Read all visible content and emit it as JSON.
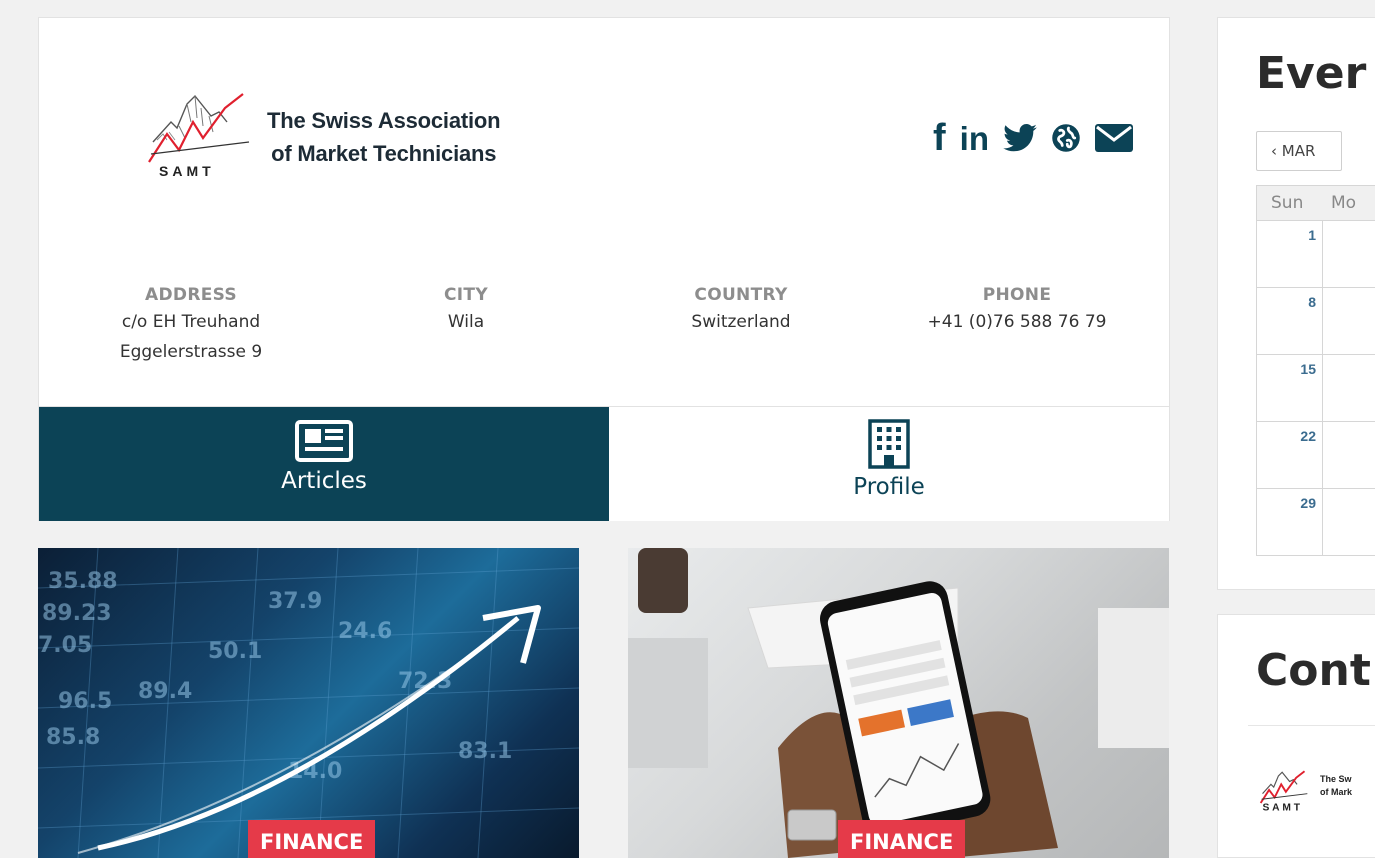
{
  "profile": {
    "logo_text_line1": "The Swiss Association",
    "logo_text_line2": "of Market Technicians",
    "logo_abbrev": "SAMT",
    "social": [
      "facebook-icon",
      "linkedin-icon",
      "twitter-icon",
      "globe-icon",
      "envelope-icon"
    ],
    "address": {
      "label": "ADDRESS",
      "line1": "c/o EH Treuhand",
      "line2": "Eggelerstrasse 9"
    },
    "city": {
      "label": "CITY",
      "value": "Wila"
    },
    "country": {
      "label": "COUNTRY",
      "value": "Switzerland"
    },
    "phone": {
      "label": "PHONE",
      "value": "+41 (0)76 588 76 79"
    },
    "tabs": [
      {
        "label": "Articles",
        "icon": "newspaper-icon",
        "active": true
      },
      {
        "label": "Profile",
        "icon": "building-icon",
        "active": false
      }
    ],
    "colors": {
      "primary": "#0c4356",
      "badge": "#e53a49"
    }
  },
  "articles": [
    {
      "category": "FINANCE"
    },
    {
      "category": "FINANCE"
    }
  ],
  "events": {
    "title": "Ever",
    "prev_label": "‹ MAR",
    "weekdays": [
      "Sun",
      "Mo"
    ],
    "first_column_days": [
      "1",
      "8",
      "15",
      "22",
      "29"
    ]
  },
  "contact": {
    "title": "Cont",
    "mini_logo_line1": "The Sw",
    "mini_logo_line2": "of Mark",
    "mini_logo_abbrev": "SAMT"
  }
}
